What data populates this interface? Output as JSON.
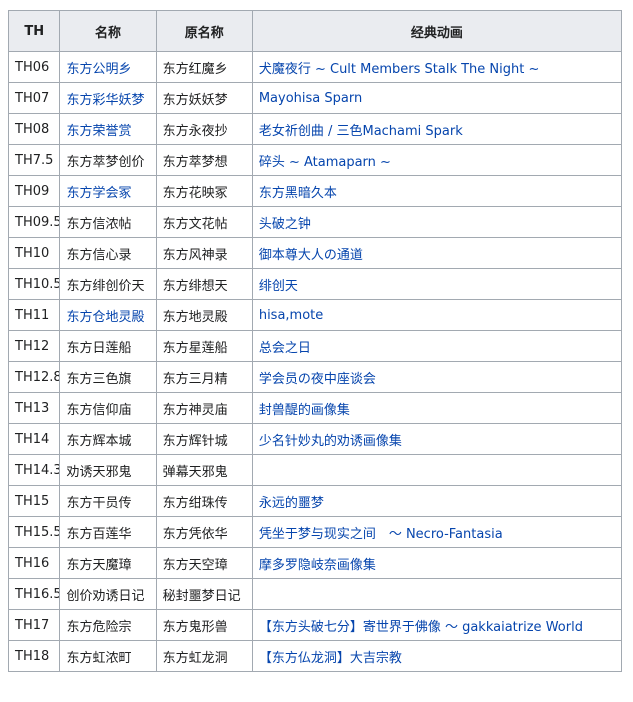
{
  "table": {
    "headers": [
      "TH",
      "名称",
      "原名称",
      "经典动画"
    ],
    "rows": [
      {
        "th": "TH06",
        "name": "东方公明乡",
        "name_link": true,
        "orig": "东方红魔乡",
        "anim": "犬魔夜行 ~ Cult Members Stalk The Night ~",
        "anim_link": true
      },
      {
        "th": "TH07",
        "name": "东方彩华妖梦",
        "name_link": true,
        "orig": "东方妖妖梦",
        "anim": "Mayohisa Sparn",
        "anim_link": true
      },
      {
        "th": "TH08",
        "name": "东方荣誉赏",
        "name_link": true,
        "orig": "东方永夜抄",
        "anim": "老女祈创曲 / 三色Machami Spark",
        "anim_link": true
      },
      {
        "th": "TH7.5",
        "name": "东方萃梦创价",
        "name_link": false,
        "orig": "东方萃梦想",
        "anim": "碎头 ~ Atamaparn ~",
        "anim_link": true
      },
      {
        "th": "TH09",
        "name": "东方学会冢",
        "name_link": true,
        "orig": "东方花映冢",
        "anim": "东方黑暗久本",
        "anim_link": true
      },
      {
        "th": "TH09.5",
        "name": "东方信浓帖",
        "name_link": false,
        "orig": "东方文花帖",
        "anim": "头破之钟",
        "anim_link": true
      },
      {
        "th": "TH10",
        "name": "东方信心录",
        "name_link": false,
        "orig": "东方风神录",
        "anim": "御本尊大人の通道",
        "anim_link": true
      },
      {
        "th": "TH10.5",
        "name": "东方绯创价天",
        "name_link": false,
        "orig": "东方绯想天",
        "anim": "绯创天",
        "anim_link": true
      },
      {
        "th": "TH11",
        "name": "东方仓地灵殿",
        "name_link": true,
        "orig": "东方地灵殿",
        "anim": "hisa,mote",
        "anim_link": true
      },
      {
        "th": "TH12",
        "name": "东方日莲船",
        "name_link": false,
        "orig": "东方星莲船",
        "anim": "总会之日",
        "anim_link": true
      },
      {
        "th": "TH12.8",
        "name": "东方三色旗",
        "name_link": false,
        "orig": "东方三月精",
        "anim": "学会员の夜中座谈会",
        "anim_link": true
      },
      {
        "th": "TH13",
        "name": "东方信仰庙",
        "name_link": false,
        "orig": "东方神灵庙",
        "anim": "封兽醍的画像集",
        "anim_link": true
      },
      {
        "th": "TH14",
        "name": "东方辉本城",
        "name_link": false,
        "orig": "东方辉针城",
        "anim": "少名针妙丸的劝诱画像集",
        "anim_link": true
      },
      {
        "th": "TH14.3",
        "name": "劝诱天邪鬼",
        "name_link": false,
        "orig": "弹幕天邪鬼",
        "anim": "",
        "anim_link": false
      },
      {
        "th": "TH15",
        "name": "东方干员传",
        "name_link": false,
        "orig": "东方绀珠传",
        "anim": "永远的噩梦",
        "anim_link": true
      },
      {
        "th": "TH15.5",
        "name": "东方百莲华",
        "name_link": false,
        "orig": "东方凭依华",
        "anim": "凭坐于梦与现实之间　～ Necro-Fantasia",
        "anim_link": true
      },
      {
        "th": "TH16",
        "name": "东方天魔璋",
        "name_link": false,
        "orig": "东方天空璋",
        "anim": "摩多罗隐岐奈画像集",
        "anim_link": true
      },
      {
        "th": "TH16.5",
        "name": "创价劝诱日记",
        "name_link": false,
        "orig": "秘封噩梦日记",
        "anim": "",
        "anim_link": false
      },
      {
        "th": "TH17",
        "name": "东方危险宗",
        "name_link": false,
        "orig": "东方鬼形兽",
        "anim": "【东方头破七分】寄世界于佛像 ～ gakkaiatrize World",
        "anim_link": true
      },
      {
        "th": "TH18",
        "name": "东方虹浓町",
        "name_link": false,
        "orig": "东方虹龙洞",
        "anim": "【东方仏龙洞】大吉宗教",
        "anim_link": true
      }
    ]
  },
  "colors": {
    "link": "#0645ad",
    "header_bg": "#eaecf0",
    "border": "#a2a9b1",
    "text": "#202122"
  }
}
